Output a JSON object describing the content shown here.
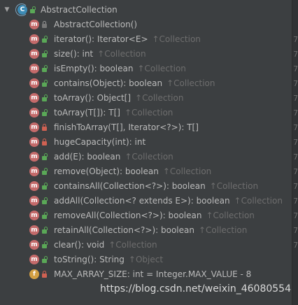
{
  "root": {
    "label": "AbstractCollection",
    "icon_letter": "C"
  },
  "members": [
    {
      "kind": "method",
      "vis": "pkg",
      "sig": "AbstractCollection()",
      "inh": ""
    },
    {
      "kind": "method",
      "vis": "public",
      "sig": "iterator(): Iterator<E>",
      "inh": "↑Collection"
    },
    {
      "kind": "method",
      "vis": "public",
      "sig": "size(): int",
      "inh": "↑Collection"
    },
    {
      "kind": "method",
      "vis": "public",
      "sig": "isEmpty(): boolean",
      "inh": "↑Collection"
    },
    {
      "kind": "method",
      "vis": "public",
      "sig": "contains(Object): boolean",
      "inh": "↑Collection"
    },
    {
      "kind": "method",
      "vis": "public",
      "sig": "toArray(): Object[]",
      "inh": "↑Collection"
    },
    {
      "kind": "method",
      "vis": "public",
      "sig": "toArray(T[]): T[]",
      "inh": "↑Collection"
    },
    {
      "kind": "method",
      "vis": "private",
      "sig": "finishToArray(T[], Iterator<?>): T[]",
      "inh": ""
    },
    {
      "kind": "method",
      "vis": "private",
      "sig": "hugeCapacity(int): int",
      "inh": ""
    },
    {
      "kind": "method",
      "vis": "public",
      "sig": "add(E): boolean",
      "inh": "↑Collection"
    },
    {
      "kind": "method",
      "vis": "public",
      "sig": "remove(Object): boolean",
      "inh": "↑Collection"
    },
    {
      "kind": "method",
      "vis": "public",
      "sig": "containsAll(Collection<?>): boolean",
      "inh": "↑Collection"
    },
    {
      "kind": "method",
      "vis": "public",
      "sig": "addAll(Collection<? extends E>): boolean",
      "inh": "↑Collection"
    },
    {
      "kind": "method",
      "vis": "public",
      "sig": "removeAll(Collection<?>): boolean",
      "inh": "↑Collection"
    },
    {
      "kind": "method",
      "vis": "public",
      "sig": "retainAll(Collection<?>): boolean",
      "inh": "↑Collection"
    },
    {
      "kind": "method",
      "vis": "public",
      "sig": "clear(): void",
      "inh": "↑Collection"
    },
    {
      "kind": "method",
      "vis": "public",
      "sig": "toString(): String",
      "inh": "↑Object"
    },
    {
      "kind": "field",
      "vis": "private",
      "sig": "MAX_ARRAY_SIZE: int = Integer.MAX_VALUE - 8",
      "inh": ""
    }
  ],
  "icon_letters": {
    "method": "m",
    "field": "f"
  },
  "gutter": [
    "7",
    "7",
    "7",
    "7",
    "7",
    "7",
    "7",
    "7",
    "7",
    "7",
    "7",
    "7",
    "7",
    "7",
    "7"
  ],
  "watermark": "https://blog.csdn.net/weixin_46080554"
}
